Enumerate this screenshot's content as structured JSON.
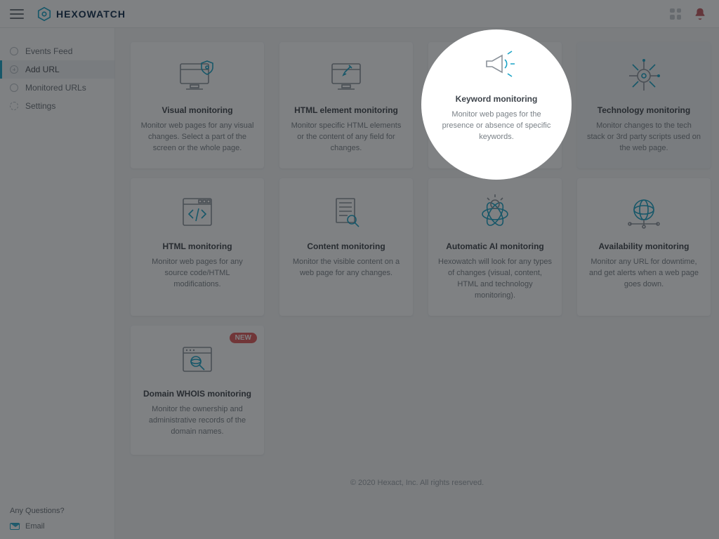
{
  "header": {
    "brand": "HEXOWATCH"
  },
  "sidebar": {
    "items": [
      {
        "label": "Events Feed"
      },
      {
        "label": "Add URL"
      },
      {
        "label": "Monitored URLs"
      },
      {
        "label": "Settings"
      }
    ],
    "questions_label": "Any Questions?",
    "email_label": "Email"
  },
  "cards": [
    {
      "title": "Visual monitoring",
      "desc": "Monitor web pages for any visual changes. Select a part of the screen or the whole page."
    },
    {
      "title": "HTML element monitoring",
      "desc": "Monitor specific HTML elements or the content of any field for changes."
    },
    {
      "title": "Keyword monitoring",
      "desc": "Monitor web pages for the presence or absence of specific keywords."
    },
    {
      "title": "Technology monitoring",
      "desc": "Monitor changes to the tech stack or 3rd party scripts used on the web page."
    },
    {
      "title": "HTML monitoring",
      "desc": "Monitor web pages for any source code/HTML modifications."
    },
    {
      "title": "Content monitoring",
      "desc": "Monitor the visible content on a web page for any changes."
    },
    {
      "title": "Automatic AI monitoring",
      "desc": "Hexowatch will look for any types of changes (visual, content, HTML and technology monitoring)."
    },
    {
      "title": "Availability monitoring",
      "desc": "Monitor any URL for downtime, and get alerts when a web page goes down."
    },
    {
      "title": "Domain WHOIS monitoring",
      "desc": "Monitor the ownership and administrative records of the domain names.",
      "badge": "NEW"
    }
  ],
  "footer": "© 2020 Hexact, Inc. All rights reserved.",
  "spotlight": {
    "title": "Keyword monitoring",
    "desc": "Monitor web pages for the presence or absence of specific keywords."
  }
}
